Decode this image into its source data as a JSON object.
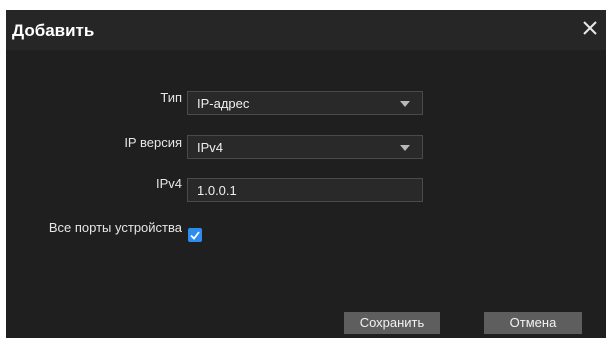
{
  "dialog": {
    "title": "Добавить",
    "close_icon": "close-icon"
  },
  "form": {
    "type": {
      "label": "Тип",
      "value": "IP-адрес"
    },
    "ip_version": {
      "label": "IP версия",
      "value": "IPv4"
    },
    "ipv4": {
      "label": "IPv4",
      "value": "1.0.0.1"
    },
    "all_ports": {
      "label": "Все порты устройства",
      "checked": true
    }
  },
  "buttons": {
    "save": "Сохранить",
    "cancel": "Отмена"
  },
  "colors": {
    "dialog_bg": "#1f1f1f",
    "titlebar_bg": "#262626",
    "field_bg": "#292929",
    "button_bg": "#5e5e5e",
    "checkbox_accent": "#2d8cf0"
  }
}
